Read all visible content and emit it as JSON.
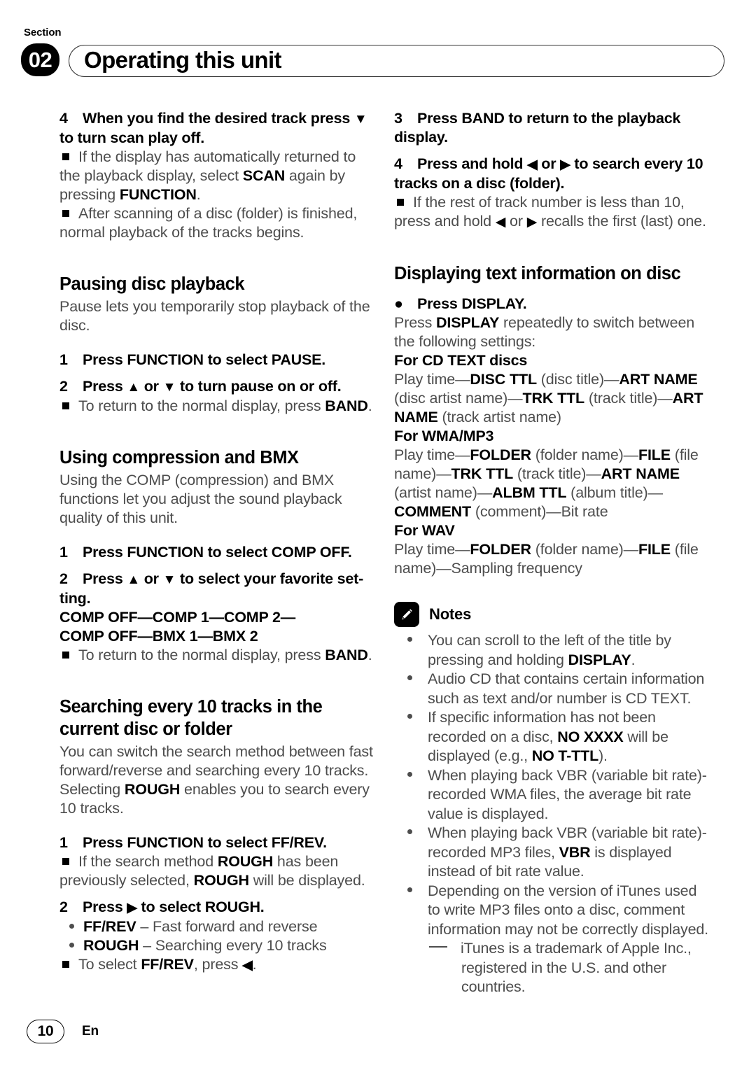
{
  "header": {
    "section_word": "Section",
    "section_number": "02",
    "title": "Operating this unit"
  },
  "footer": {
    "page_number": "10",
    "language": "En"
  },
  "left_column": {
    "step4": {
      "num": "4",
      "text_part1": "When you find the desired track press ",
      "arrow": "▼",
      "text_part2": " to turn scan play off."
    },
    "note_scan": {
      "p1": "If the display has automatically returned to the playback display, select ",
      "b1": "SCAN",
      "p2": " again by pressing ",
      "b2": "FUNCTION",
      "p3": "."
    },
    "note_after_scan": "After scanning of a disc (folder) is finished, normal playback of the tracks begins.",
    "pausing": {
      "heading": "Pausing disc playback",
      "intro": "Pause lets you temporarily stop playback of the disc.",
      "step1_num": "1",
      "step1": "Press FUNCTION to select PAUSE.",
      "step2_num": "2",
      "step2_a": "Press ",
      "step2_up": "▲",
      "step2_b": " or ",
      "step2_down": "▼",
      "step2_c": " to turn pause on or off.",
      "note_a": "To return to the normal display, press ",
      "note_b": "BAND",
      "note_c": "."
    },
    "compression": {
      "heading": "Using compression and BMX",
      "intro": "Using the COMP (compression) and BMX functions let you adjust the sound playback quality of this unit.",
      "step1_num": "1",
      "step1": "Press FUNCTION to select COMP OFF.",
      "step2_num": "2",
      "step2_a": "Press ",
      "step2_up": "▲",
      "step2_b": " or ",
      "step2_down": "▼",
      "step2_c": " to select your favorite set-ting.",
      "chain_line1": "COMP OFF—COMP 1—COMP 2—",
      "chain_line2": "COMP OFF—BMX 1—BMX 2",
      "note_a": "To return to the normal display, press ",
      "note_b": "BAND",
      "note_c": "."
    },
    "searching": {
      "heading": "Searching every 10 tracks in the current disc or folder",
      "intro_a": "You can switch the search method between fast forward/reverse and searching every 10 tracks. Selecting ",
      "intro_b": "ROUGH",
      "intro_c": " enables you to search every 10 tracks.",
      "step1_num": "1",
      "step1": "Press FUNCTION to select FF/REV.",
      "note1_a": "If the search method ",
      "note1_b": "ROUGH",
      "note1_c": " has been previously selected, ",
      "note1_d": "ROUGH",
      "note1_e": " will be displayed.",
      "step2_num": "2",
      "step2_a": "Press ",
      "step2_arrow": "▶",
      "step2_b": " to select ROUGH.",
      "opt1_b": "FF/REV",
      "opt1_t": " – Fast forward and reverse",
      "opt2_b": "ROUGH",
      "opt2_t": " – Searching every 10 tracks",
      "note2_a": "To select ",
      "note2_b": "FF/REV",
      "note2_c": ", press ",
      "note2_arrow": "◀",
      "note2_d": "."
    }
  },
  "right_column": {
    "step3": {
      "num": "3",
      "text": "Press BAND to return to the playback display."
    },
    "step4": {
      "num": "4",
      "a": "Press and hold ",
      "left_arrow": "◀",
      "b": " or ",
      "right_arrow": "▶",
      "c": " to search every 10 tracks on a disc (folder)."
    },
    "step4_note": {
      "a": "If the rest of track number is less than 10, press and hold ",
      "left_arrow": "◀",
      "b": " or ",
      "right_arrow": "▶",
      "c": " recalls the first (last) one."
    },
    "displaying": {
      "heading": "Displaying text information on disc",
      "bullet_step": "Press DISPLAY.",
      "intro_a": "Press ",
      "intro_b": "DISPLAY",
      "intro_c": " repeatedly to switch between the following settings:",
      "cdtext_head_a": "For ",
      "cdtext_head_b": "CD TEXT",
      "cdtext_head_c": " discs",
      "cdtext_line": [
        {
          "t": "Play time—",
          "b": false
        },
        {
          "t": "DISC TTL",
          "b": true
        },
        {
          "t": " (disc title)—",
          "b": false
        },
        {
          "t": "ART NAME",
          "b": true
        },
        {
          "t": " (disc artist name)—",
          "b": false
        },
        {
          "t": "TRK TTL",
          "b": true
        },
        {
          "t": " (track title)—",
          "b": false
        },
        {
          "t": "ART NAME",
          "b": true
        },
        {
          "t": " (track artist name)",
          "b": false
        }
      ],
      "wma_head": "For WMA/MP3",
      "wma_line": [
        {
          "t": "Play time—",
          "b": false
        },
        {
          "t": "FOLDER",
          "b": true
        },
        {
          "t": " (folder name)—",
          "b": false
        },
        {
          "t": "FILE",
          "b": true
        },
        {
          "t": " (file name)—",
          "b": false
        },
        {
          "t": "TRK TTL",
          "b": true
        },
        {
          "t": " (track title)—",
          "b": false
        },
        {
          "t": "ART NAME",
          "b": true
        },
        {
          "t": " (artist name)—",
          "b": false
        },
        {
          "t": "ALBM TTL",
          "b": true
        },
        {
          "t": " (album title)—",
          "b": false
        },
        {
          "t": "COMMENT",
          "b": true
        },
        {
          "t": " (comment)—Bit rate",
          "b": false
        }
      ],
      "wav_head": "For WAV",
      "wav_line": [
        {
          "t": "Play time—",
          "b": false
        },
        {
          "t": "FOLDER",
          "b": true
        },
        {
          "t": " (folder name)—",
          "b": false
        },
        {
          "t": "FILE",
          "b": true
        },
        {
          "t": " (file name)—Sampling frequency",
          "b": false
        }
      ]
    },
    "notes": {
      "icon": "pencil-icon",
      "label": "Notes",
      "items": [
        [
          {
            "t": "You can scroll to the left of the title by pressing and holding ",
            "b": false
          },
          {
            "t": "DISPLAY",
            "b": true
          },
          {
            "t": ".",
            "b": false
          }
        ],
        [
          {
            "t": "Audio CD that contains certain information such as text and/or number is CD TEXT.",
            "b": false
          }
        ],
        [
          {
            "t": "If specific information has not been recorded on a disc, ",
            "b": false
          },
          {
            "t": "NO XXXX",
            "b": true
          },
          {
            "t": " will be displayed (e.g., ",
            "b": false
          },
          {
            "t": "NO T-TTL",
            "b": true
          },
          {
            "t": ").",
            "b": false
          }
        ],
        [
          {
            "t": "When playing back VBR (variable bit rate)-recorded WMA files, the average bit rate value is displayed.",
            "b": false
          }
        ],
        [
          {
            "t": "When playing back VBR (variable bit rate)-recorded MP3 files, ",
            "b": false
          },
          {
            "t": "VBR",
            "b": true
          },
          {
            "t": " is displayed instead of bit rate value.",
            "b": false
          }
        ],
        [
          {
            "t": "Depending on the version of iTunes used to write MP3 files onto a disc, comment information may not be correctly displayed.",
            "b": false
          }
        ]
      ],
      "sub_item": "iTunes is a trademark of Apple Inc., registered in the U.S. and other countries."
    }
  }
}
